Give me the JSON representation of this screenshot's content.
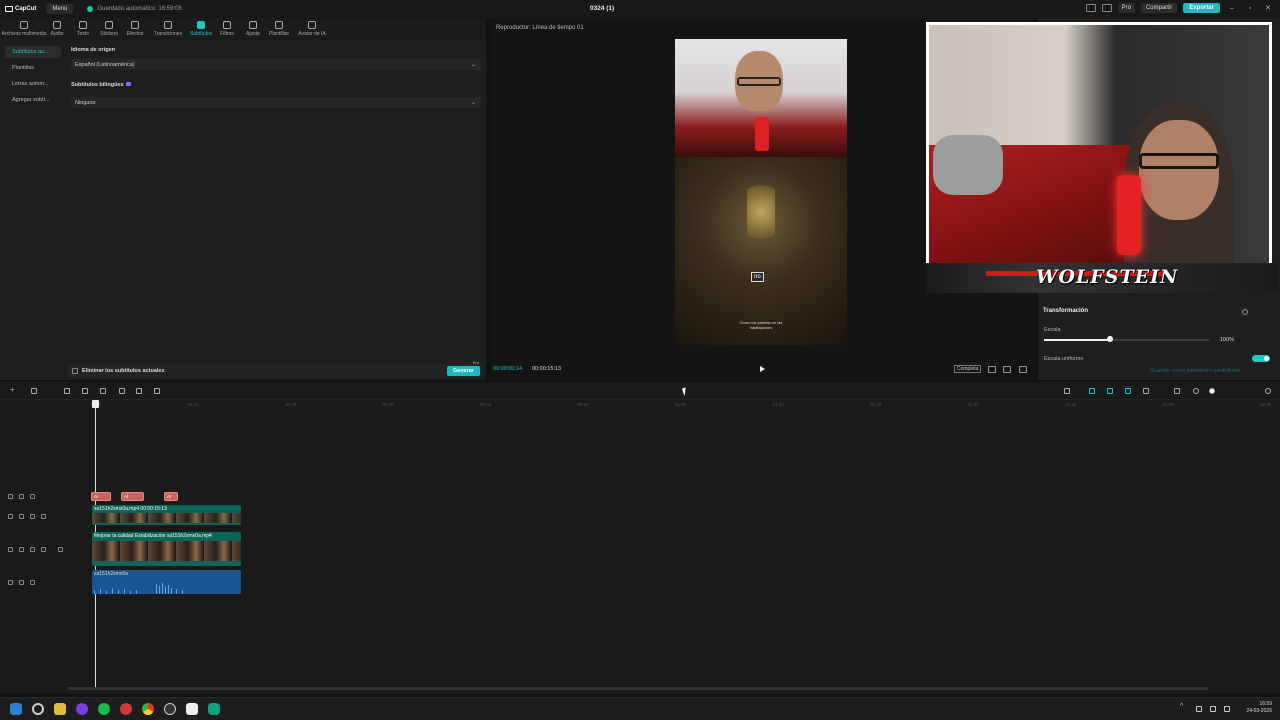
{
  "titlebar": {
    "app_name": "CapCut",
    "menu_label": "Menú",
    "autosave": "Guardado automático: 16:59:08",
    "project_title": "0324 (1)",
    "pro_label": "Pro",
    "share_label": "Compartir",
    "export_label": "Exportar"
  },
  "tools": [
    {
      "label": "Archivos multimedia",
      "icon": "media-icon"
    },
    {
      "label": "Audio",
      "icon": "audio-icon"
    },
    {
      "label": "Texto",
      "icon": "text-icon"
    },
    {
      "label": "Stickers",
      "icon": "sticker-icon"
    },
    {
      "label": "Efectos",
      "icon": "effects-icon"
    },
    {
      "label": "Transiciones",
      "icon": "transitions-icon"
    },
    {
      "label": "Subtítulos",
      "icon": "captions-icon",
      "active": true
    },
    {
      "label": "Filtros",
      "icon": "filters-icon"
    },
    {
      "label": "Ajuste",
      "icon": "adjust-icon"
    },
    {
      "label": "Plantillas",
      "icon": "templates-icon"
    },
    {
      "label": "Avatar de IA",
      "icon": "avatar-icon"
    }
  ],
  "side_nav": [
    "Subtítulos au...",
    "Plantillas",
    "Letras autom...",
    "Agregar subtí..."
  ],
  "captions": {
    "source_language_label": "Idioma de origen",
    "source_language_value": "Español (Latinoamérica)",
    "bilingual_label": "Subtítulos bilingües",
    "bilingual_value": "Ninguno",
    "remove_current_label": "Eliminar los subtítulos actuales",
    "generate_label": "Generar",
    "generate_badge": "Pro"
  },
  "player": {
    "title": "Reproductor: Línea de tiempo 01",
    "caption_overlay": "no",
    "subtitle_in_video": "Cómo las plantas en las habitaciones",
    "current_time": "00:00:00:14",
    "total_time": "00:00:15:13",
    "complete_label": "Completa"
  },
  "properties": {
    "section_title": "Transformación",
    "scale_label": "Escala",
    "scale_value": "100%",
    "scale_fraction": 0.4,
    "uniform_scale_label": "Escala uniforme",
    "uniform_scale_on": true,
    "default_button": "Guardar como parámetro predefinido"
  },
  "webcam": {
    "logo_text": "WOLFSTEIN"
  },
  "timeline": {
    "ruler_labels": [
      "00:00",
      "00:10",
      "00:20",
      "00:30",
      "00:40",
      "00:50",
      "01:00",
      "01:10",
      "01:20",
      "01:30",
      "01:40",
      "01:50",
      "02:00"
    ],
    "subtitle_clips": [
      {
        "label": "Al"
      },
      {
        "label": "Al"
      },
      {
        "label": "Al"
      }
    ],
    "video_clip_1": "xa151h2smx0a.mp4  00:00:15:13",
    "video_clip_2": "Mejorar la calidad   Estabilización   xa151h2smx0a.mp4",
    "audio_clip": "xa151h2smx0a"
  },
  "taskbar": {
    "time": "16:59",
    "date": "24-03-2026"
  }
}
